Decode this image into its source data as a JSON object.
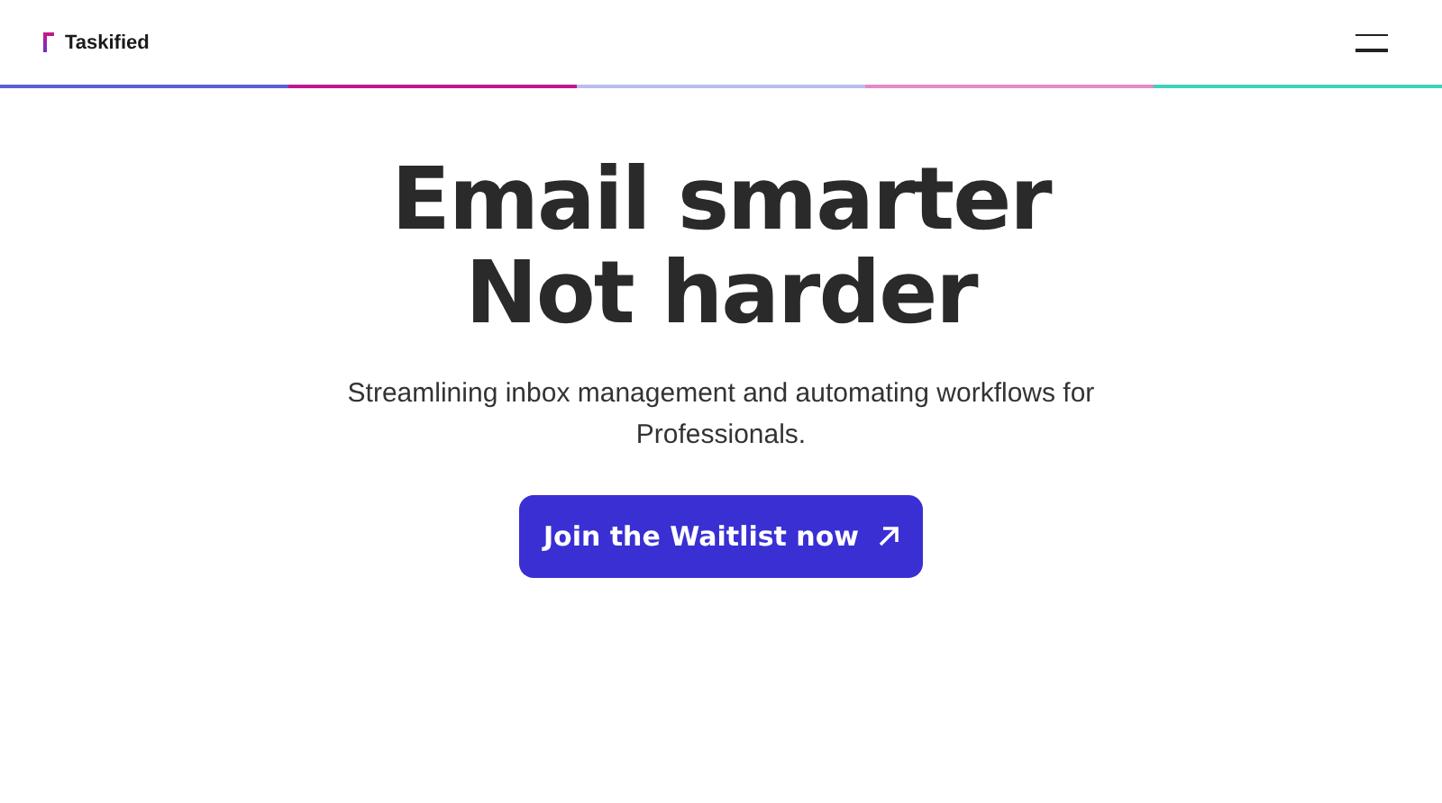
{
  "brand": {
    "name": "Taskified"
  },
  "hero": {
    "headline": [
      "Email smarter",
      "Not harder"
    ],
    "subtitle": "Streamlining inbox management and automating workflows for Professionals.",
    "cta": "Join the Waitlist now"
  }
}
